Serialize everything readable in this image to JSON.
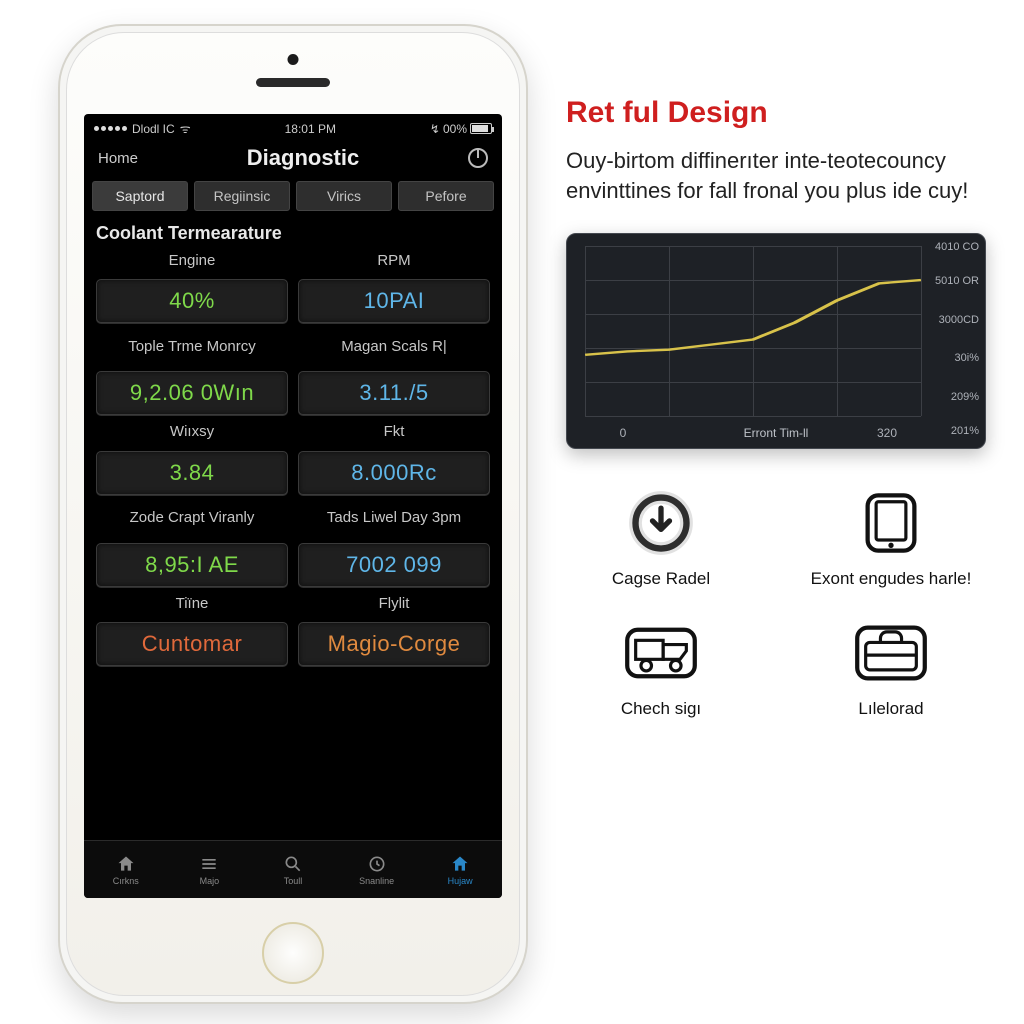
{
  "status_bar": {
    "carrier": "Dlodl IC",
    "time": "18:01 PM",
    "battery_text": "00%"
  },
  "nav": {
    "back": "Home",
    "title": "Diagnostic"
  },
  "tabs": [
    "Saptord",
    "Regiinsic",
    "Virics",
    "Pefore"
  ],
  "section_heading": "Coolant Termearature",
  "cells": [
    {
      "label": "Engine",
      "value": "40%",
      "color": "c-green"
    },
    {
      "label": "RPM",
      "value": "10PAI",
      "color": "c-blue"
    },
    {
      "label": "Tople Trme Monrcy",
      "value": "9,2.06 0Wın",
      "color": "c-green"
    },
    {
      "label": "Magan Scals R|",
      "value": "3.11./5",
      "color": "c-blue"
    },
    {
      "label": "Wiıxsy",
      "value": "3.84",
      "color": "c-green"
    },
    {
      "label": "Fkt",
      "value": "8.000Rc",
      "color": "c-blue"
    },
    {
      "label": "Zode Crapt Viranly",
      "value": "8,95:I AE",
      "color": "c-green"
    },
    {
      "label": "Tads Liwel Day 3pm",
      "value": "7002 099",
      "color": "c-blue"
    },
    {
      "label": "Tiïne",
      "value": "Cuntomar",
      "color": "c-orange2"
    },
    {
      "label": "Flylit",
      "value": "Magio-Corge",
      "color": "c-orange"
    }
  ],
  "tab_bar": [
    "Cırkns",
    "Majo",
    "Toull",
    "Snanline",
    "Hujaw"
  ],
  "marketing": {
    "headline": "Ret ful Design",
    "blurb": "Ouy-birtom diffinerıter inte-teotecouncy envinttines for fall fronal you plus ide cuy!"
  },
  "chart_data": {
    "type": "line",
    "title": "",
    "xlabel": "Erront Tim-ll",
    "ylabel": "",
    "y_ticks": [
      "4010 CO",
      "5010 OR",
      "3000CD",
      "30i%",
      "209%",
      "201%"
    ],
    "x_ticks": [
      0,
      320
    ],
    "x": [
      0,
      40,
      80,
      120,
      160,
      200,
      240,
      280,
      320
    ],
    "values": [
      0.36,
      0.38,
      0.39,
      0.42,
      0.45,
      0.55,
      0.68,
      0.78,
      0.8
    ]
  },
  "features": [
    {
      "label": "Cagse Radel"
    },
    {
      "label": "Exont engudes harle!"
    },
    {
      "label": "Chech sigı"
    },
    {
      "label": "Lılelorad"
    }
  ]
}
